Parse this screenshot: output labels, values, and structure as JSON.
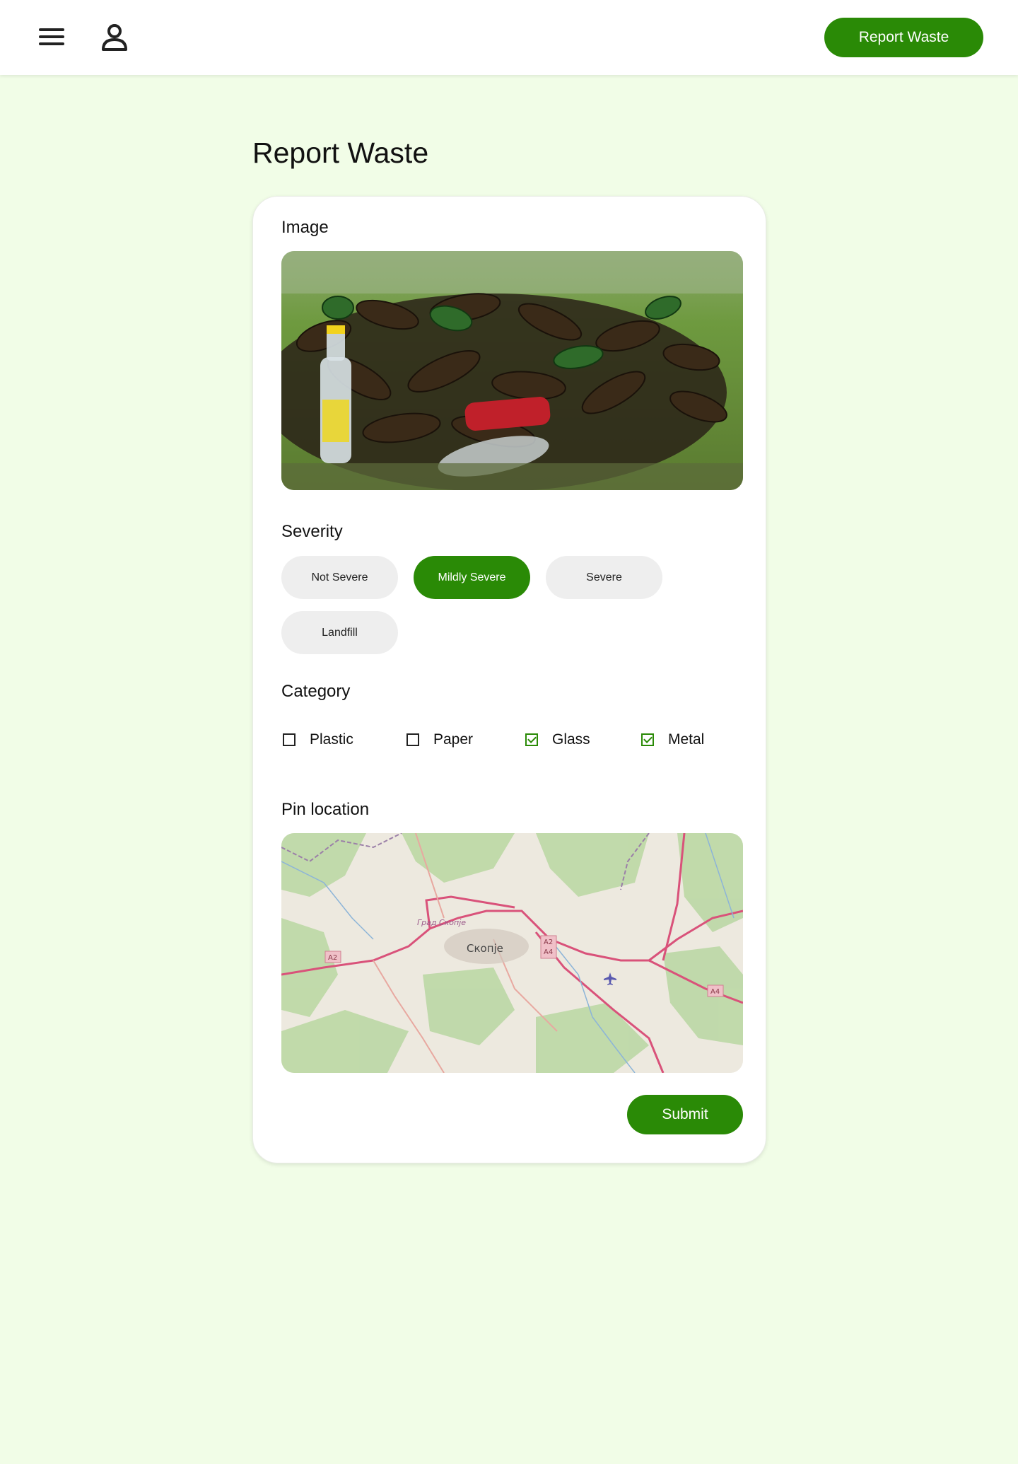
{
  "header": {
    "menu_icon": "hamburger-menu-icon",
    "profile_icon": "user-profile-icon",
    "report_button_label": "Report Waste"
  },
  "page": {
    "title": "Report Waste"
  },
  "form": {
    "image_label": "Image",
    "photo_description_icon": "waste-photo-glass-bottles",
    "severity_label": "Severity",
    "severity_options": [
      {
        "label": "Not Severe",
        "selected": false
      },
      {
        "label": "Mildly Severe",
        "selected": true
      },
      {
        "label": "Severe",
        "selected": false
      },
      {
        "label": "Landfill",
        "selected": false
      }
    ],
    "category_label": "Category",
    "categories": [
      {
        "label": "Plastic",
        "checked": false
      },
      {
        "label": "Paper",
        "checked": false
      },
      {
        "label": "Glass",
        "checked": true
      },
      {
        "label": "Metal",
        "checked": true
      }
    ],
    "location_label": "Pin location",
    "map": {
      "city_label": "Скопје",
      "district_label": "Град Скопје",
      "road_shields": [
        "A2",
        "A2",
        "A4",
        "A4"
      ],
      "airport_icon": "airplane-icon"
    },
    "submit_label": "Submit"
  },
  "colors": {
    "accent": "#2a8a06",
    "page_background": "#f1fde7",
    "chip_background": "#eeeeee"
  }
}
